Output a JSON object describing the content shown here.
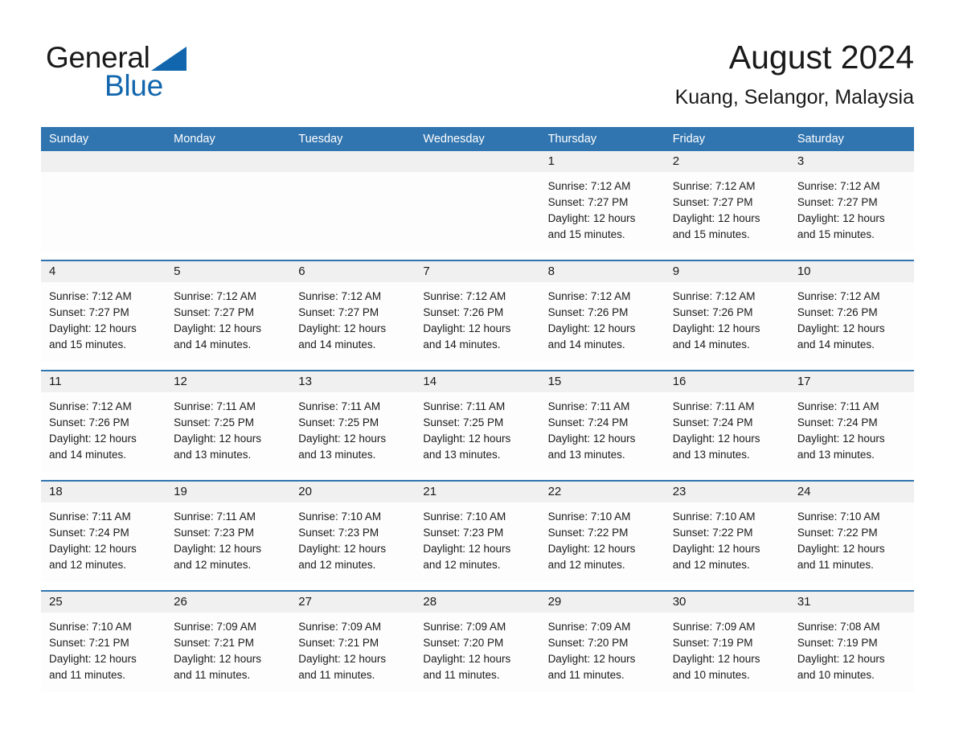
{
  "brand": {
    "name_part1": "General",
    "name_part2": "Blue",
    "triangle_icon": "brand-triangle-icon",
    "accent_color": "#1266ad"
  },
  "header": {
    "title": "August 2024",
    "subtitle": "Kuang, Selangor, Malaysia"
  },
  "calendar": {
    "header_bg": "#3175b0",
    "daynum_band_bg": "#f0f0f0",
    "weekdays": [
      "Sunday",
      "Monday",
      "Tuesday",
      "Wednesday",
      "Thursday",
      "Friday",
      "Saturday"
    ],
    "weeks": [
      [
        {
          "day": "",
          "lines": []
        },
        {
          "day": "",
          "lines": []
        },
        {
          "day": "",
          "lines": []
        },
        {
          "day": "",
          "lines": []
        },
        {
          "day": "1",
          "lines": [
            "Sunrise: 7:12 AM",
            "Sunset: 7:27 PM",
            "Daylight: 12 hours",
            "and 15 minutes."
          ]
        },
        {
          "day": "2",
          "lines": [
            "Sunrise: 7:12 AM",
            "Sunset: 7:27 PM",
            "Daylight: 12 hours",
            "and 15 minutes."
          ]
        },
        {
          "day": "3",
          "lines": [
            "Sunrise: 7:12 AM",
            "Sunset: 7:27 PM",
            "Daylight: 12 hours",
            "and 15 minutes."
          ]
        }
      ],
      [
        {
          "day": "4",
          "lines": [
            "Sunrise: 7:12 AM",
            "Sunset: 7:27 PM",
            "Daylight: 12 hours",
            "and 15 minutes."
          ]
        },
        {
          "day": "5",
          "lines": [
            "Sunrise: 7:12 AM",
            "Sunset: 7:27 PM",
            "Daylight: 12 hours",
            "and 14 minutes."
          ]
        },
        {
          "day": "6",
          "lines": [
            "Sunrise: 7:12 AM",
            "Sunset: 7:27 PM",
            "Daylight: 12 hours",
            "and 14 minutes."
          ]
        },
        {
          "day": "7",
          "lines": [
            "Sunrise: 7:12 AM",
            "Sunset: 7:26 PM",
            "Daylight: 12 hours",
            "and 14 minutes."
          ]
        },
        {
          "day": "8",
          "lines": [
            "Sunrise: 7:12 AM",
            "Sunset: 7:26 PM",
            "Daylight: 12 hours",
            "and 14 minutes."
          ]
        },
        {
          "day": "9",
          "lines": [
            "Sunrise: 7:12 AM",
            "Sunset: 7:26 PM",
            "Daylight: 12 hours",
            "and 14 minutes."
          ]
        },
        {
          "day": "10",
          "lines": [
            "Sunrise: 7:12 AM",
            "Sunset: 7:26 PM",
            "Daylight: 12 hours",
            "and 14 minutes."
          ]
        }
      ],
      [
        {
          "day": "11",
          "lines": [
            "Sunrise: 7:12 AM",
            "Sunset: 7:26 PM",
            "Daylight: 12 hours",
            "and 14 minutes."
          ]
        },
        {
          "day": "12",
          "lines": [
            "Sunrise: 7:11 AM",
            "Sunset: 7:25 PM",
            "Daylight: 12 hours",
            "and 13 minutes."
          ]
        },
        {
          "day": "13",
          "lines": [
            "Sunrise: 7:11 AM",
            "Sunset: 7:25 PM",
            "Daylight: 12 hours",
            "and 13 minutes."
          ]
        },
        {
          "day": "14",
          "lines": [
            "Sunrise: 7:11 AM",
            "Sunset: 7:25 PM",
            "Daylight: 12 hours",
            "and 13 minutes."
          ]
        },
        {
          "day": "15",
          "lines": [
            "Sunrise: 7:11 AM",
            "Sunset: 7:24 PM",
            "Daylight: 12 hours",
            "and 13 minutes."
          ]
        },
        {
          "day": "16",
          "lines": [
            "Sunrise: 7:11 AM",
            "Sunset: 7:24 PM",
            "Daylight: 12 hours",
            "and 13 minutes."
          ]
        },
        {
          "day": "17",
          "lines": [
            "Sunrise: 7:11 AM",
            "Sunset: 7:24 PM",
            "Daylight: 12 hours",
            "and 13 minutes."
          ]
        }
      ],
      [
        {
          "day": "18",
          "lines": [
            "Sunrise: 7:11 AM",
            "Sunset: 7:24 PM",
            "Daylight: 12 hours",
            "and 12 minutes."
          ]
        },
        {
          "day": "19",
          "lines": [
            "Sunrise: 7:11 AM",
            "Sunset: 7:23 PM",
            "Daylight: 12 hours",
            "and 12 minutes."
          ]
        },
        {
          "day": "20",
          "lines": [
            "Sunrise: 7:10 AM",
            "Sunset: 7:23 PM",
            "Daylight: 12 hours",
            "and 12 minutes."
          ]
        },
        {
          "day": "21",
          "lines": [
            "Sunrise: 7:10 AM",
            "Sunset: 7:23 PM",
            "Daylight: 12 hours",
            "and 12 minutes."
          ]
        },
        {
          "day": "22",
          "lines": [
            "Sunrise: 7:10 AM",
            "Sunset: 7:22 PM",
            "Daylight: 12 hours",
            "and 12 minutes."
          ]
        },
        {
          "day": "23",
          "lines": [
            "Sunrise: 7:10 AM",
            "Sunset: 7:22 PM",
            "Daylight: 12 hours",
            "and 12 minutes."
          ]
        },
        {
          "day": "24",
          "lines": [
            "Sunrise: 7:10 AM",
            "Sunset: 7:22 PM",
            "Daylight: 12 hours",
            "and 11 minutes."
          ]
        }
      ],
      [
        {
          "day": "25",
          "lines": [
            "Sunrise: 7:10 AM",
            "Sunset: 7:21 PM",
            "Daylight: 12 hours",
            "and 11 minutes."
          ]
        },
        {
          "day": "26",
          "lines": [
            "Sunrise: 7:09 AM",
            "Sunset: 7:21 PM",
            "Daylight: 12 hours",
            "and 11 minutes."
          ]
        },
        {
          "day": "27",
          "lines": [
            "Sunrise: 7:09 AM",
            "Sunset: 7:21 PM",
            "Daylight: 12 hours",
            "and 11 minutes."
          ]
        },
        {
          "day": "28",
          "lines": [
            "Sunrise: 7:09 AM",
            "Sunset: 7:20 PM",
            "Daylight: 12 hours",
            "and 11 minutes."
          ]
        },
        {
          "day": "29",
          "lines": [
            "Sunrise: 7:09 AM",
            "Sunset: 7:20 PM",
            "Daylight: 12 hours",
            "and 11 minutes."
          ]
        },
        {
          "day": "30",
          "lines": [
            "Sunrise: 7:09 AM",
            "Sunset: 7:19 PM",
            "Daylight: 12 hours",
            "and 10 minutes."
          ]
        },
        {
          "day": "31",
          "lines": [
            "Sunrise: 7:08 AM",
            "Sunset: 7:19 PM",
            "Daylight: 12 hours",
            "and 10 minutes."
          ]
        }
      ]
    ]
  }
}
